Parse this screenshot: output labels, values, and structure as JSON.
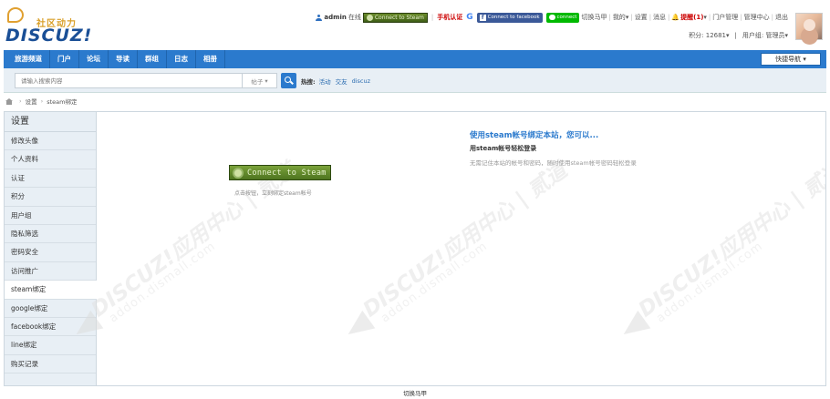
{
  "logo": {
    "cn": "社区动力",
    "en": "DISCUZ!"
  },
  "topbar": {
    "username": "admin",
    "online": "在线",
    "steam_small": "Connect to Steam",
    "mobile": "手机认证",
    "google_icon": "G",
    "facebook": "Connect to facebook",
    "line": "connect",
    "switch": "切换马甲",
    "my": "我的",
    "settings": "设置",
    "messages": "消息",
    "remind": "提醒(1)",
    "portal_admin": "门户管理",
    "admin_center": "管理中心",
    "logout": "退出",
    "credits": "积分: 12681",
    "usergroup": "用户组: 管理员"
  },
  "nav": {
    "items": [
      "旅游频道",
      "门户",
      "论坛",
      "导读",
      "群组",
      "日志",
      "相册"
    ],
    "quick": "快捷导航"
  },
  "search": {
    "placeholder": "请输入搜索内容",
    "type": "帖子",
    "hot_label": "热搜:",
    "hot": [
      "活动",
      "交友",
      "discuz"
    ]
  },
  "breadcrumb": {
    "settings": "设置",
    "current": "steam绑定"
  },
  "sidebar": {
    "title": "设置",
    "items": [
      "修改头像",
      "个人资料",
      "认证",
      "积分",
      "用户组",
      "隐私筛选",
      "密码安全",
      "访问推广",
      "steam绑定",
      "google绑定",
      "facebook绑定",
      "line绑定",
      "购买记录"
    ]
  },
  "content": {
    "steam_button": "Connect to Steam",
    "steam_hint": "点击按钮，立刻绑定steam帐号",
    "info_title": "使用steam帐号绑定本站，您可以...",
    "info_sub": "用steam帐号轻松登录",
    "info_desc": "无需记住本站的帐号和密码，随时使用steam帐号密码轻松登录"
  },
  "footer": {
    "switch": "切换马甲"
  }
}
